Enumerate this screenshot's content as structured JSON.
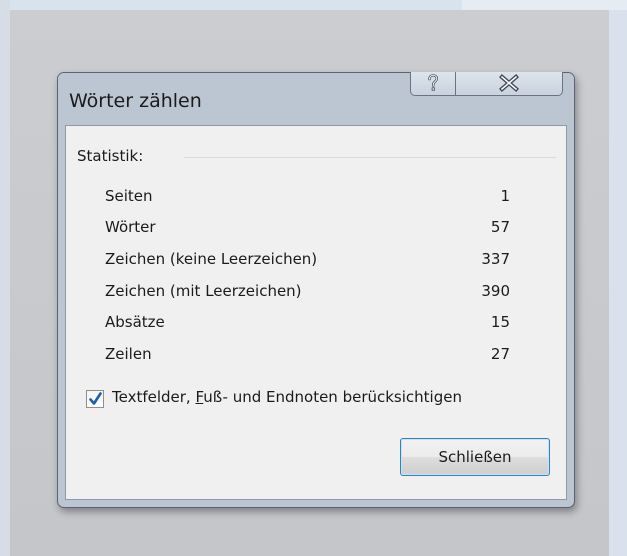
{
  "window": {
    "title": "Wörter zählen",
    "help_icon": "question-mark-icon",
    "close_icon": "x-close-icon"
  },
  "statistics": {
    "group_label": "Statistik:",
    "rows": [
      {
        "label": "Seiten",
        "value": "1"
      },
      {
        "label": "Wörter",
        "value": "57"
      },
      {
        "label": "Zeichen (keine Leerzeichen)",
        "value": "337"
      },
      {
        "label": "Zeichen (mit Leerzeichen)",
        "value": "390"
      },
      {
        "label": "Absätze",
        "value": "15"
      },
      {
        "label": "Zeilen",
        "value": "27"
      }
    ]
  },
  "options": {
    "include_checkbox": {
      "checked": true,
      "label_before": "Textfelder, ",
      "label_mnemonic": "F",
      "label_after": "uß- und Endnoten berücksichtigen"
    }
  },
  "buttons": {
    "close_label": "Schließen"
  },
  "colors": {
    "window_frame": "#bcc6d2",
    "client_background": "#f0f0f0",
    "button_focus_border": "#3c7fb1",
    "checkmark": "#1f5fa8"
  }
}
